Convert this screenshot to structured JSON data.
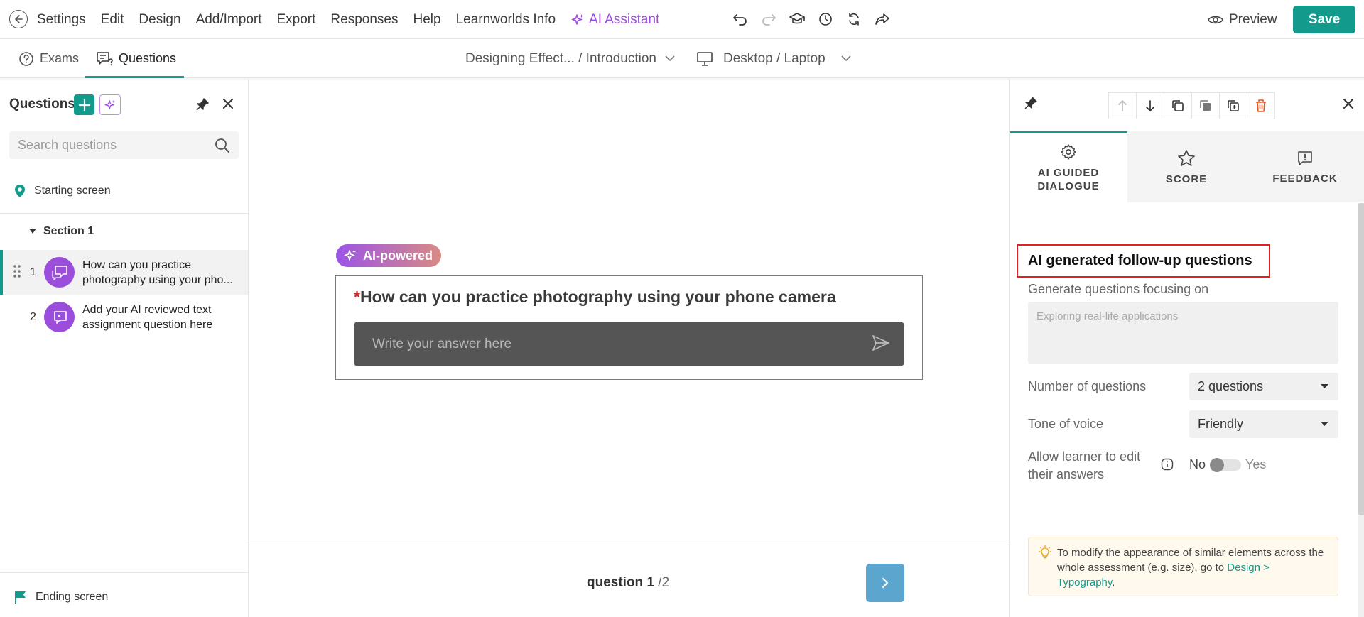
{
  "topbar": {
    "menu": [
      "Settings",
      "Edit",
      "Design",
      "Add/Import",
      "Export",
      "Responses",
      "Help",
      "Learnworlds Info"
    ],
    "ai_assistant": "AI Assistant",
    "preview": "Preview",
    "save": "Save"
  },
  "subbar": {
    "tabs": [
      {
        "label": "Exams"
      },
      {
        "label": "Questions"
      }
    ],
    "breadcrumb": "Designing Effect... / Introduction",
    "device": "Desktop / Laptop"
  },
  "left": {
    "title": "Questions",
    "search_placeholder": "Search questions",
    "starting_screen": "Starting screen",
    "section": "Section 1",
    "questions": [
      {
        "num": "1",
        "text": "How can you practice photography using your pho..."
      },
      {
        "num": "2",
        "text": "Add your AI reviewed text assignment question here"
      }
    ],
    "ending_screen": "Ending screen"
  },
  "center": {
    "badge": "AI-powered",
    "required_mark": "*",
    "question": "How can you practice photography using your phone camera",
    "answer_placeholder": "Write your answer here",
    "pager_current": "question 1",
    "pager_total": "/2"
  },
  "right": {
    "tabs": [
      {
        "label": "AI GUIDED DIALOGUE",
        "icon": "gear-icon"
      },
      {
        "label": "SCORE",
        "icon": "star-icon"
      },
      {
        "label": "FEEDBACK",
        "icon": "feedback-icon"
      }
    ],
    "heading": "AI generated follow-up questions",
    "focus_label": "Generate questions focusing on",
    "focus_placeholder": "Exploring real-life applications",
    "num_questions_label": "Number of questions",
    "num_questions_value": "2 questions",
    "tone_label": "Tone of voice",
    "tone_value": "Friendly",
    "allow_edit_label": "Allow learner to edit their answers",
    "toggle_no": "No",
    "toggle_yes": "Yes",
    "toggle_on": false,
    "tip_text": "To modify the appearance of similar elements across the whole assessment (e.g. size), go to ",
    "tip_link": "Design > Typography",
    "tip_end": "."
  },
  "colors": {
    "accent": "#129a8c",
    "ai_purple": "#9b4ddb",
    "highlight_red": "#e02020",
    "next_button": "#5ba6cf"
  }
}
